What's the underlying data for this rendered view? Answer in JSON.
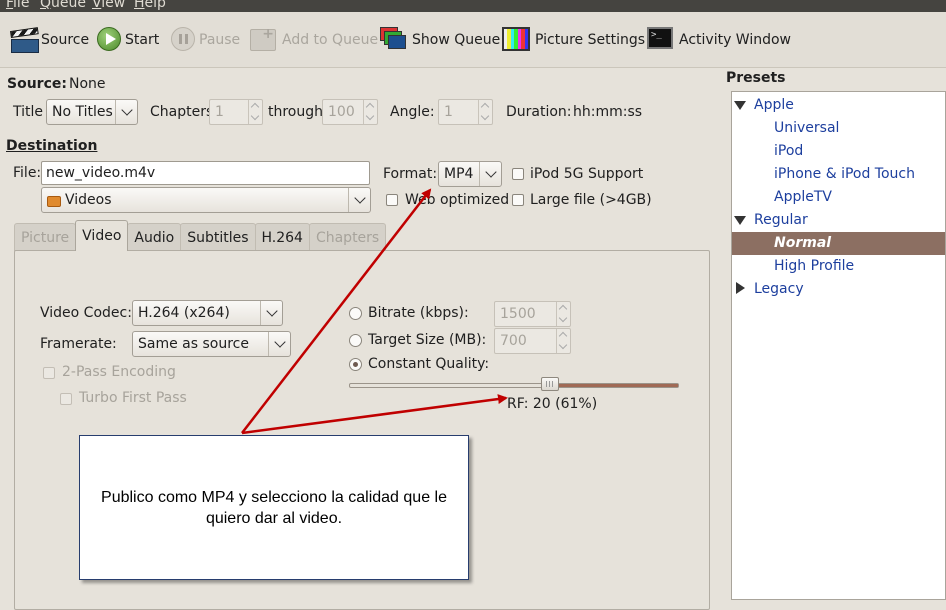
{
  "menu": [
    "File",
    "Queue",
    "View",
    "Help"
  ],
  "toolbar": {
    "source": "Source",
    "start": "Start",
    "pause": "Pause",
    "add_queue": "Add to Queue",
    "show_queue": "Show Queue",
    "picture_settings": "Picture Settings",
    "activity_window": "Activity Window"
  },
  "source": {
    "label": "Source:",
    "value": "None",
    "title_label": "Title",
    "title_value": "No Titles",
    "chapters_label": "Chapters",
    "chapters_from": "1",
    "through_label": "through",
    "chapters_to": "100",
    "angle_label": "Angle:",
    "angle_value": "1",
    "duration_label": "Duration:",
    "duration_value": "hh:mm:ss"
  },
  "destination": {
    "heading": "Destination",
    "file_label": "File:",
    "file_value": "new_video.m4v",
    "folder": "Videos",
    "format_label": "Format:",
    "format_value": "MP4",
    "ipod_label": "iPod 5G Support",
    "web_label": "Web optimized",
    "large_label": "Large file (>4GB)"
  },
  "tabs": [
    "Picture",
    "Video",
    "Audio",
    "Subtitles",
    "H.264",
    "Chapters"
  ],
  "video": {
    "codec_label": "Video Codec:",
    "codec_value": "H.264 (x264)",
    "framerate_label": "Framerate:",
    "framerate_value": "Same as source",
    "twopass_label": "2-Pass Encoding",
    "turbo_label": "Turbo First Pass",
    "bitrate_label": "Bitrate (kbps):",
    "bitrate_value": "1500",
    "target_label": "Target Size (MB):",
    "target_value": "700",
    "quality_label": "Constant Quality:",
    "quality_fraction": 0.61,
    "rf_label": "RF: 20 (61%)"
  },
  "presets": {
    "heading": "Presets",
    "items": [
      "Apple",
      "Universal",
      "iPod",
      "iPhone & iPod Touch",
      "AppleTV",
      "Regular",
      "Normal",
      "High Profile",
      "Legacy"
    ]
  },
  "annotation": "Publico como MP4 y selecciono la calidad que le quiero dar al video.",
  "colors": {
    "selected": "#8c6f62",
    "preset_text": "#1d3f9e",
    "arrow": "#c00000"
  }
}
